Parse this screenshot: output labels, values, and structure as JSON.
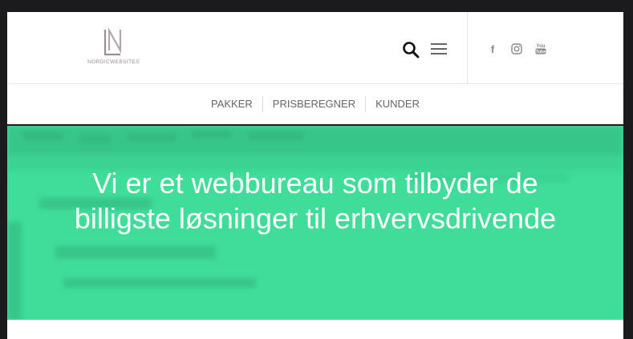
{
  "header": {
    "logo_text": "NORDICWEBSITES",
    "icons": [
      "search-icon",
      "hamburger-menu-icon"
    ],
    "social": [
      {
        "name": "facebook-icon",
        "glyph": "f"
      },
      {
        "name": "instagram-icon"
      },
      {
        "name": "youtube-icon",
        "glyph": "You Tube"
      }
    ]
  },
  "nav": {
    "items": [
      {
        "label": "PAKKER"
      },
      {
        "label": "PRISBEREGNER"
      },
      {
        "label": "KUNDER"
      }
    ]
  },
  "hero": {
    "title": "Vi er et webbureau som tilbyder de billigste løsninger til erhvervsdrivende",
    "bg_color": "#3fdc9a"
  },
  "colors": {
    "accent": "#3fdc9a",
    "logo": "#9a8e95",
    "nav_text": "#666666"
  }
}
